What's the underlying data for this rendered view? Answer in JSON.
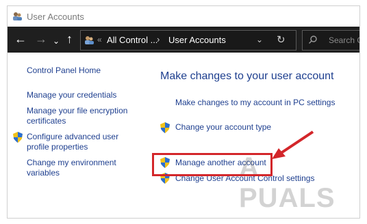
{
  "window": {
    "title": "User Accounts"
  },
  "address_bar": {
    "prefix": "«",
    "crumb1": "All Control ...",
    "separator": "›",
    "crumb2": "User Accounts"
  },
  "search": {
    "placeholder": "Search C"
  },
  "sidebar": {
    "items": [
      {
        "label": "Control Panel Home"
      },
      {
        "label": "Manage your credentials"
      },
      {
        "label": "Manage your file encryption certificates"
      },
      {
        "label": "Configure advanced user profile properties"
      },
      {
        "label": "Change my environment variables"
      }
    ]
  },
  "main": {
    "title": "Make changes to your user account",
    "links": [
      {
        "label": "Make changes to my account in PC settings"
      },
      {
        "label": "Change your account type"
      },
      {
        "label": "Manage another account"
      },
      {
        "label": "Change User Account Control settings"
      }
    ]
  },
  "watermark": "A  PUALS",
  "colors": {
    "link": "#1e3f8f",
    "navbar": "#1f1f1f",
    "highlight": "#d3262a"
  }
}
